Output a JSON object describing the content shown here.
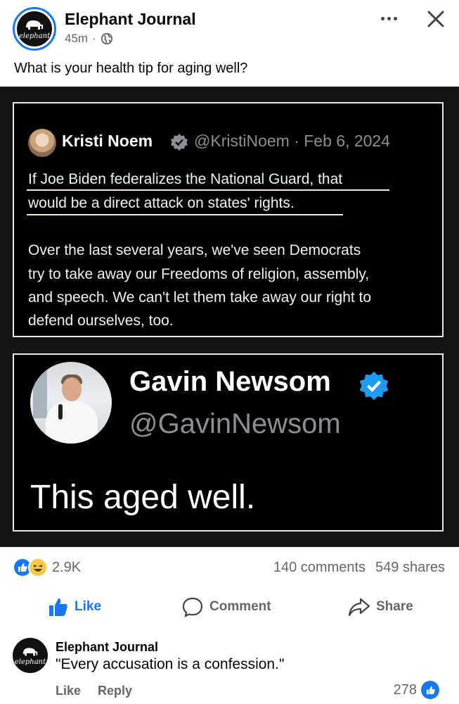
{
  "post": {
    "page_name": "Elephant Journal",
    "time": "45m",
    "separator": "·",
    "avatar_text": "elephant",
    "text": "What is your health tip for aging well?"
  },
  "image": {
    "tweet1": {
      "name": "Kristi Noem",
      "handle": "@KristiNoem · Feb 6, 2024",
      "lines": [
        "If Joe Biden federalizes the National Guard, that",
        "would be a direct attack on states' rights.",
        "Over the last several years, we've seen Democrats",
        "try to take away our Freedoms of religion, assembly,",
        "and speech. We can't let them take away our right to",
        "defend ourselves, too."
      ]
    },
    "tweet2": {
      "name": "Gavin Newsom",
      "handle": "@GavinNewsom",
      "text": "This aged well."
    }
  },
  "stats": {
    "reactions": "2.9K",
    "comments": "140 comments",
    "shares": "549 shares"
  },
  "actions": {
    "like": "Like",
    "comment": "Comment",
    "share": "Share"
  },
  "comment": {
    "author": "Elephant Journal",
    "text": "\"Every accusation is a confession.\"",
    "like": "Like",
    "reply": "Reply",
    "likes": "278"
  },
  "colors": {
    "brand_blue": "#1877f2",
    "secondary_text": "#65676b",
    "verified_gray": "#8b8f94"
  }
}
